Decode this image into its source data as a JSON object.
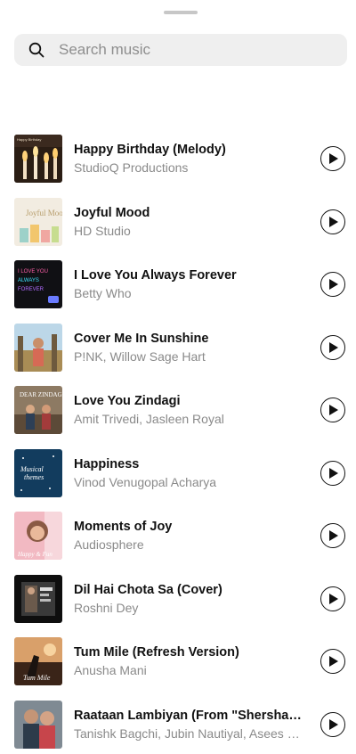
{
  "search": {
    "placeholder": "Search music",
    "icon": "search-icon"
  },
  "tracks": [
    {
      "title": "Happy Birthday (Melody)",
      "artist": "StudioQ Productions",
      "thumb_caption": "Happy Birthday"
    },
    {
      "title": "Joyful Mood",
      "artist": "HD Studio",
      "thumb_caption": "Joyful Mood"
    },
    {
      "title": "I Love You Always Forever",
      "artist": "Betty Who",
      "thumb_caption": "I LOVE YOU ALWAYS FOREVER"
    },
    {
      "title": "Cover Me In Sunshine",
      "artist": "P!NK, Willow Sage Hart",
      "thumb_caption": ""
    },
    {
      "title": "Love You Zindagi",
      "artist": "Amit Trivedi, Jasleen Royal",
      "thumb_caption": "DEAR ZINDAGI"
    },
    {
      "title": "Happiness",
      "artist": "Vinod Venugopal Acharya",
      "thumb_caption": "Musical themes"
    },
    {
      "title": "Moments of Joy",
      "artist": "Audiosphere",
      "thumb_caption": "Happy & Fun"
    },
    {
      "title": "Dil Hai Chota Sa (Cover)",
      "artist": "Roshni Dey",
      "thumb_caption": ""
    },
    {
      "title": "Tum Mile (Refresh Version)",
      "artist": "Anusha Mani",
      "thumb_caption": "Tum Mile"
    },
    {
      "title": "Raataan Lambiyan (From \"Shershaah\")",
      "artist": "Tanishk Bagchi, Jubin Nautiyal, Asees Kaur",
      "thumb_caption": ""
    }
  ],
  "colors": {
    "title": "#111111",
    "artist": "#8a8a8a",
    "search_bg": "#efefef"
  }
}
